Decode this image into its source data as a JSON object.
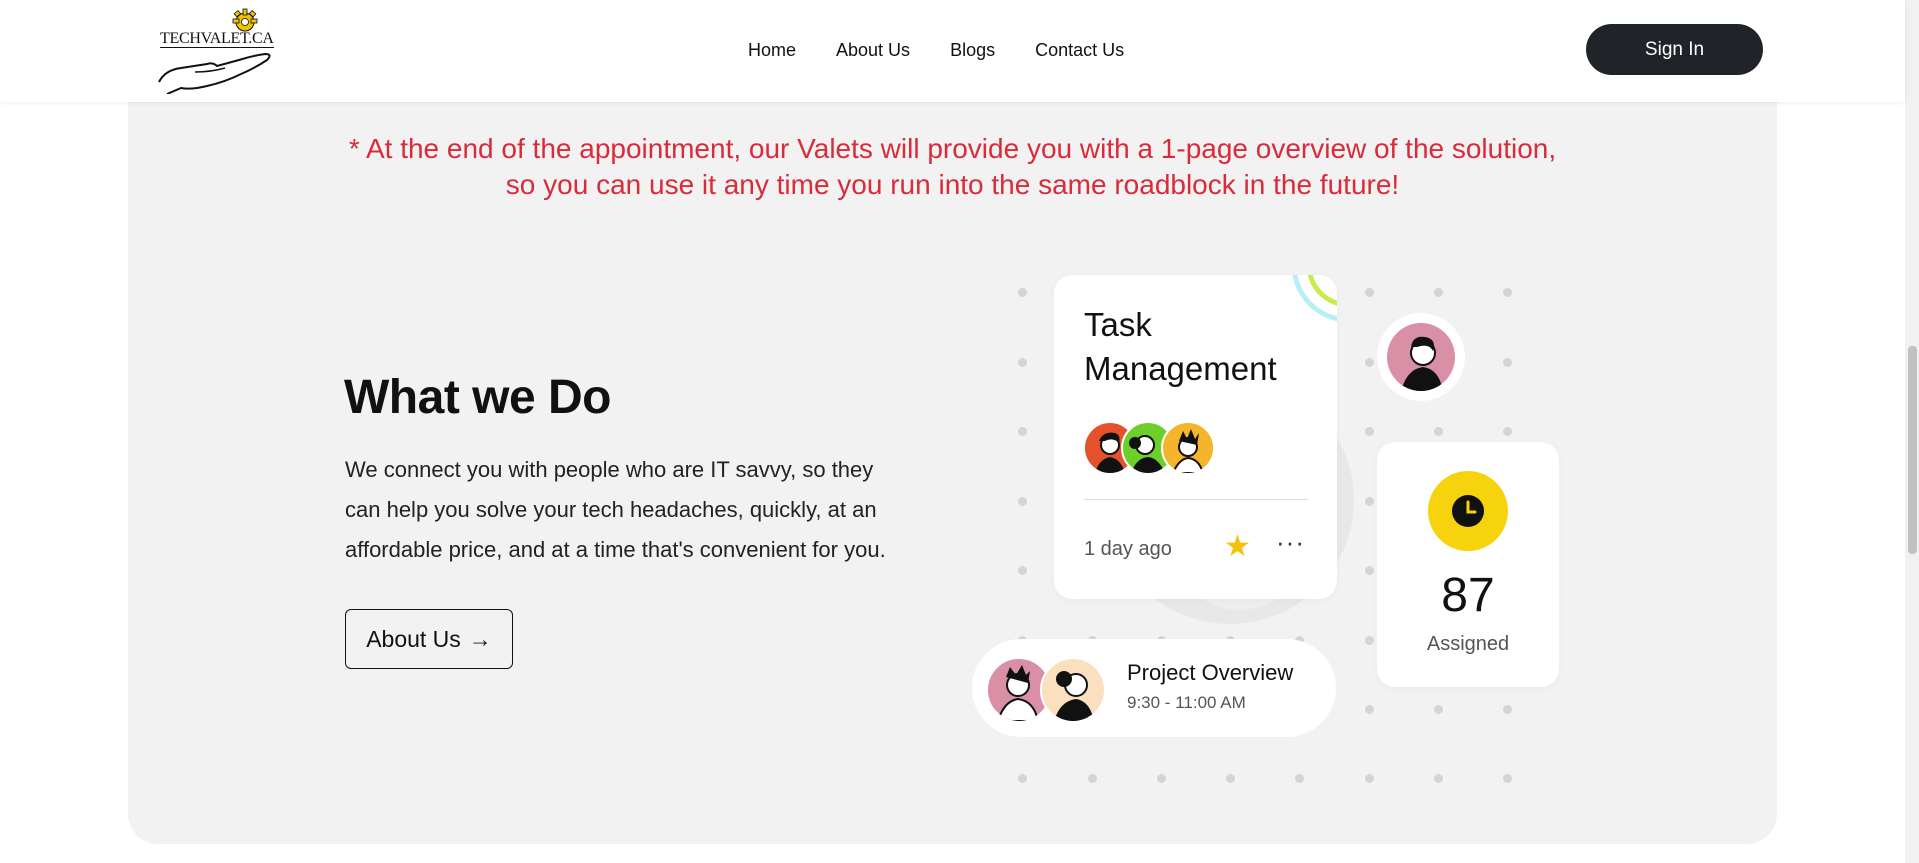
{
  "header": {
    "logo_text": "TECHVALET.CA",
    "nav": [
      "Home",
      "About Us",
      "Blogs",
      "Contact Us"
    ],
    "signin_label": "Sign In"
  },
  "note": {
    "line1": "* At the end of the appointment, our Valets will provide you with a 1-page overview of the solution,",
    "line2": "so you can use it any time you run into the same roadblock in the future!"
  },
  "section": {
    "title": "What we Do",
    "description_lines": [
      "We connect you with people who are IT savvy, so they",
      "can help you solve your tech headaches, quickly, at an",
      "affordable price, and at a time that's convenient for you."
    ],
    "about_button": "About Us",
    "about_button_arrow": "→"
  },
  "task_card": {
    "title_line1": "Task",
    "title_line2": "Management",
    "time_ago": "1 day ago",
    "star": "★",
    "more": "···"
  },
  "assigned_card": {
    "count": "87",
    "label": "Assigned"
  },
  "project_card": {
    "title": "Project Overview",
    "time": "9:30 - 11:00 AM"
  },
  "icons": {
    "logo": "hand-gear-logo",
    "clock": "clock-icon",
    "star": "star-icon",
    "more": "more-dots-icon"
  },
  "colors": {
    "note_red": "#d92b3a",
    "signin_bg": "#202428",
    "panel_bg": "#f2f2f2",
    "clock_yellow": "#f6d30d",
    "star_yellow": "#f4c20d"
  }
}
